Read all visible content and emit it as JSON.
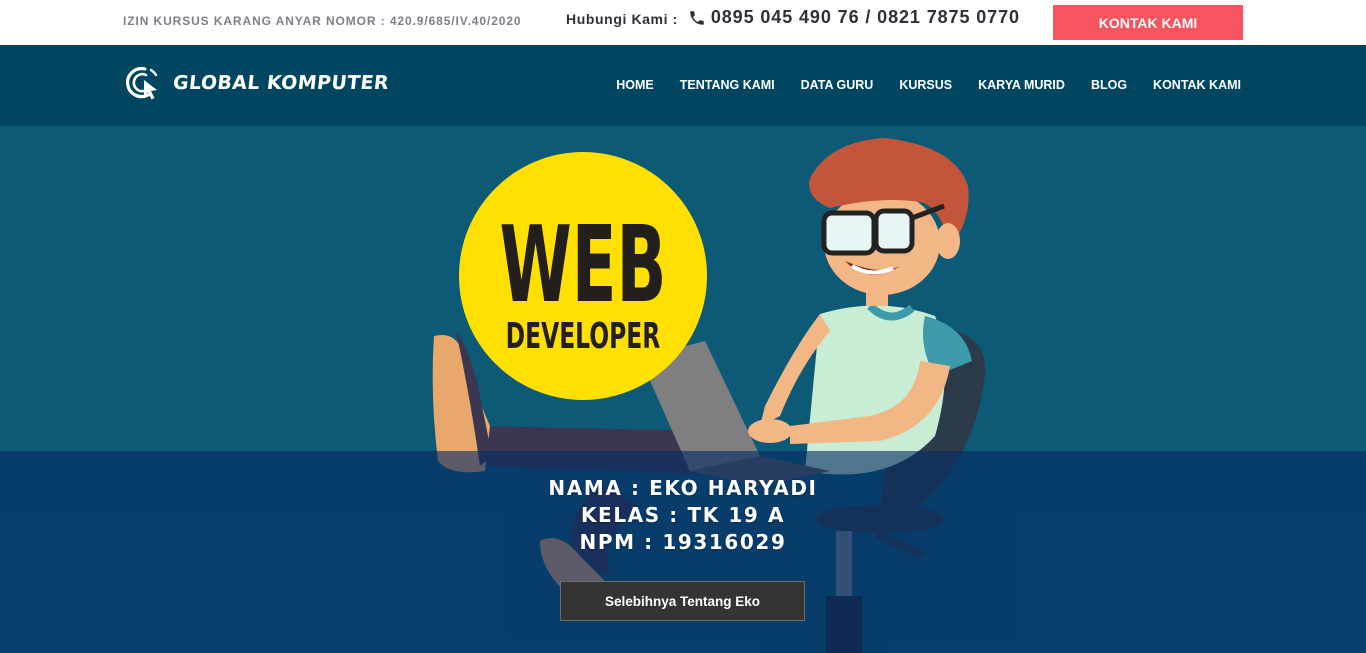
{
  "topbar": {
    "license": "IZIN KURSUS KARANG ANYAR NOMOR : 420.9/685/IV.40/2020",
    "contact_label": "Hubungi Kami :",
    "phone_icon": "phone-icon",
    "phone_numbers": "0895 045 490 76 / 0821 7875 0770",
    "cta_label": "KONTAK KAMI"
  },
  "nav": {
    "logo_text": "GLOBAL KOMPUTER",
    "items": [
      {
        "label": "HOME"
      },
      {
        "label": "TENTANG KAMI"
      },
      {
        "label": "DATA GURU"
      },
      {
        "label": "KURSUS"
      },
      {
        "label": "KARYA MURID"
      },
      {
        "label": "BLOG"
      },
      {
        "label": "KONTAK KAMI"
      }
    ]
  },
  "hero": {
    "badge_line1": "WEB",
    "badge_line2": "DEVELOPER",
    "nama": "NAMA : EKO HARYADI",
    "kelas": "KELAS : TK 19 A",
    "npm": "NPM : 19316029",
    "button_label": "Selebihnya Tentang Eko"
  },
  "colors": {
    "topbar_bg": "#ffffff",
    "nav_bg": "#004661",
    "hero_bg": "#0d5a77",
    "accent_red": "#f65560",
    "badge_yellow": "#ffe000",
    "button_dark": "#343434"
  }
}
